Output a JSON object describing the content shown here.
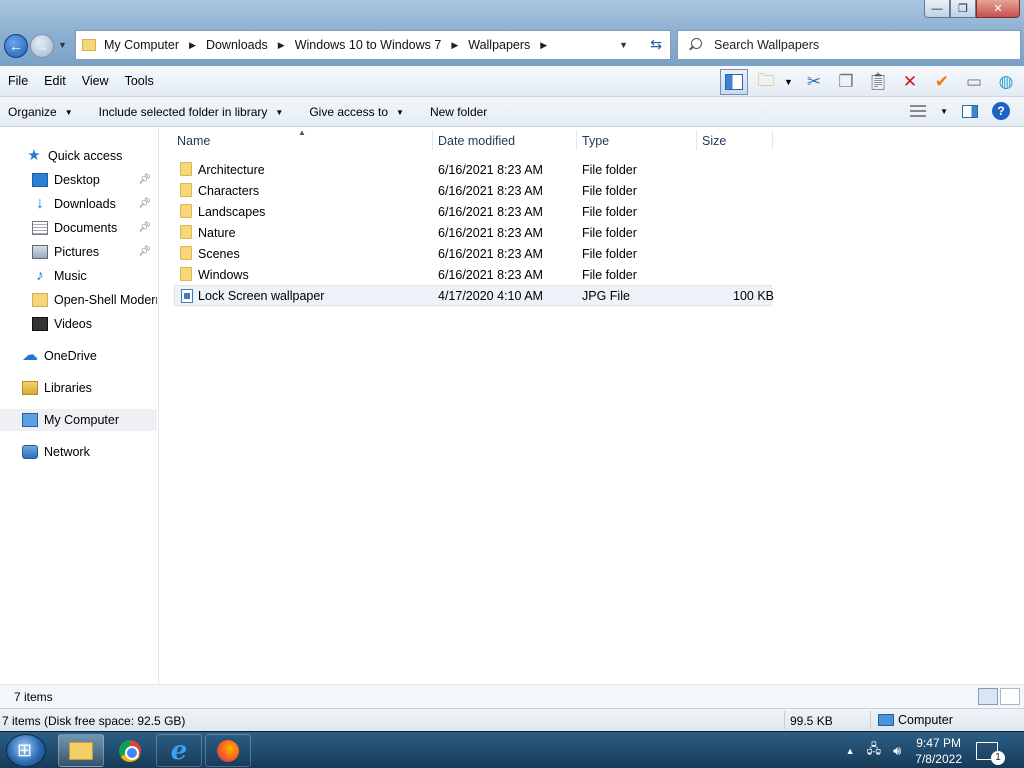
{
  "window": {
    "controls": {
      "minimize": "—",
      "maximize": "❐",
      "close": "✕"
    }
  },
  "navigation": {
    "back_icon": "arrow-left-icon",
    "forward_icon": "arrow-right-icon"
  },
  "address": {
    "crumbs": [
      "My Computer",
      "Downloads",
      "Windows 10 to Windows 7",
      "Wallpapers"
    ],
    "refresh_icon": "refresh-icon"
  },
  "search": {
    "placeholder": "Search Wallpapers"
  },
  "menubar": {
    "items": [
      "File",
      "Edit",
      "View",
      "Tools"
    ]
  },
  "toolbar_icons": [
    "preview-pane-icon",
    "new-folder-icon",
    "cut-icon",
    "copy-icon",
    "paste-icon",
    "delete-icon",
    "select-icon",
    "rename-icon",
    "shell-globe-icon"
  ],
  "commandbar": {
    "organize": "Organize",
    "include_library": "Include selected folder in library",
    "give_access": "Give access to",
    "new_folder": "New folder"
  },
  "navpane": {
    "quick_access": "Quick access",
    "items": [
      {
        "label": "Desktop",
        "icon": "desktop-icon",
        "pinned": true
      },
      {
        "label": "Downloads",
        "icon": "downloads-icon",
        "pinned": true
      },
      {
        "label": "Documents",
        "icon": "documents-icon",
        "pinned": true
      },
      {
        "label": "Pictures",
        "icon": "pictures-icon",
        "pinned": true
      },
      {
        "label": "Music",
        "icon": "music-icon",
        "pinned": false
      },
      {
        "label": "Open-Shell Modern",
        "icon": "folder-icon",
        "pinned": false
      },
      {
        "label": "Videos",
        "icon": "videos-icon",
        "pinned": false
      }
    ],
    "onedrive": "OneDrive",
    "libraries": "Libraries",
    "my_computer": "My Computer",
    "network": "Network"
  },
  "filelist": {
    "columns": {
      "name": "Name",
      "date": "Date modified",
      "type": "Type",
      "size": "Size"
    },
    "rows": [
      {
        "name": "Architecture",
        "date": "6/16/2021 8:23 AM",
        "type": "File folder",
        "size": ""
      },
      {
        "name": "Characters",
        "date": "6/16/2021 8:23 AM",
        "type": "File folder",
        "size": ""
      },
      {
        "name": "Landscapes",
        "date": "6/16/2021 8:23 AM",
        "type": "File folder",
        "size": ""
      },
      {
        "name": "Nature",
        "date": "6/16/2021 8:23 AM",
        "type": "File folder",
        "size": ""
      },
      {
        "name": "Scenes",
        "date": "6/16/2021 8:23 AM",
        "type": "File folder",
        "size": ""
      },
      {
        "name": "Windows",
        "date": "6/16/2021 8:23 AM",
        "type": "File folder",
        "size": ""
      },
      {
        "name": "Lock Screen wallpaper",
        "date": "4/17/2020 4:10 AM",
        "type": "JPG File",
        "size": "100 KB"
      }
    ]
  },
  "status": {
    "items_count": "7 items",
    "details": "7 items (Disk free space: 92.5 GB)",
    "size": "99.5 KB",
    "location": "Computer"
  },
  "taskbar": {
    "apps": [
      "file-explorer-icon",
      "chrome-icon",
      "internet-explorer-icon",
      "firefox-icon"
    ],
    "clock_time": "9:47 PM",
    "clock_date": "7/8/2022",
    "notification_count": "1"
  },
  "colors": {
    "titlebar": "#8fb2d2",
    "taskbar": "#163a58",
    "accent": "#1e63c4"
  }
}
